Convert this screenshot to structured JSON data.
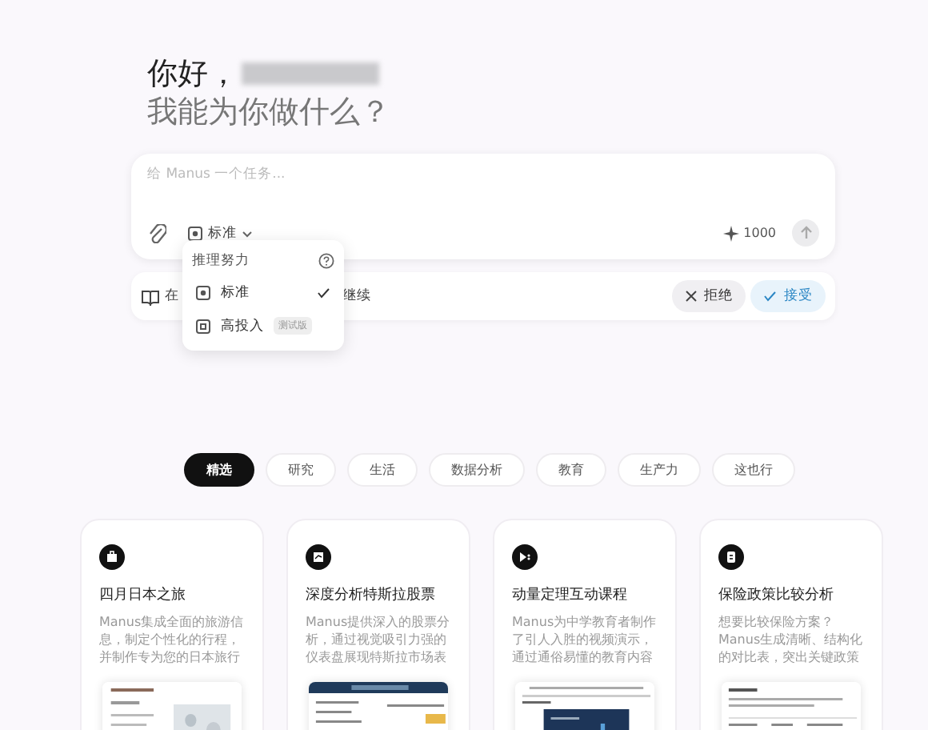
{
  "greeting": {
    "hello": "你好，",
    "question": "我能为你做什么？"
  },
  "composer": {
    "placeholder": "给 Manus 一个任务...",
    "mode": "标准",
    "credits": "1000"
  },
  "effort_menu": {
    "title": "推理努力",
    "items": [
      {
        "label": "标准",
        "selected": true
      },
      {
        "label": "高投入",
        "selected": false,
        "badge": "测试版"
      }
    ]
  },
  "banner": {
    "text_start": "在",
    "text_end": "继续",
    "reject": "拒绝",
    "accept": "接受"
  },
  "tabs": [
    {
      "label": "精选",
      "selected": true
    },
    {
      "label": "研究",
      "selected": false
    },
    {
      "label": "生活",
      "selected": false
    },
    {
      "label": "数据分析",
      "selected": false
    },
    {
      "label": "教育",
      "selected": false
    },
    {
      "label": "生产力",
      "selected": false
    },
    {
      "label": "这也行",
      "selected": false
    }
  ],
  "cards": [
    {
      "title": "四月日本之旅",
      "description": "Manus集成全面的旅游信息，制定个性化的行程，并制作专为您的日本旅行"
    },
    {
      "title": "深度分析特斯拉股票",
      "description": "Manus提供深入的股票分析，通过视觉吸引力强的仪表盘展现特斯拉市场表"
    },
    {
      "title": "动量定理互动课程",
      "description": "Manus为中学教育者制作了引人入胜的视频演示，通过通俗易懂的教育内容"
    },
    {
      "title": "保险政策比较分析",
      "description": "想要比较保险方案？Manus生成清晰、结构化的对比表，突出关键政策"
    }
  ]
}
